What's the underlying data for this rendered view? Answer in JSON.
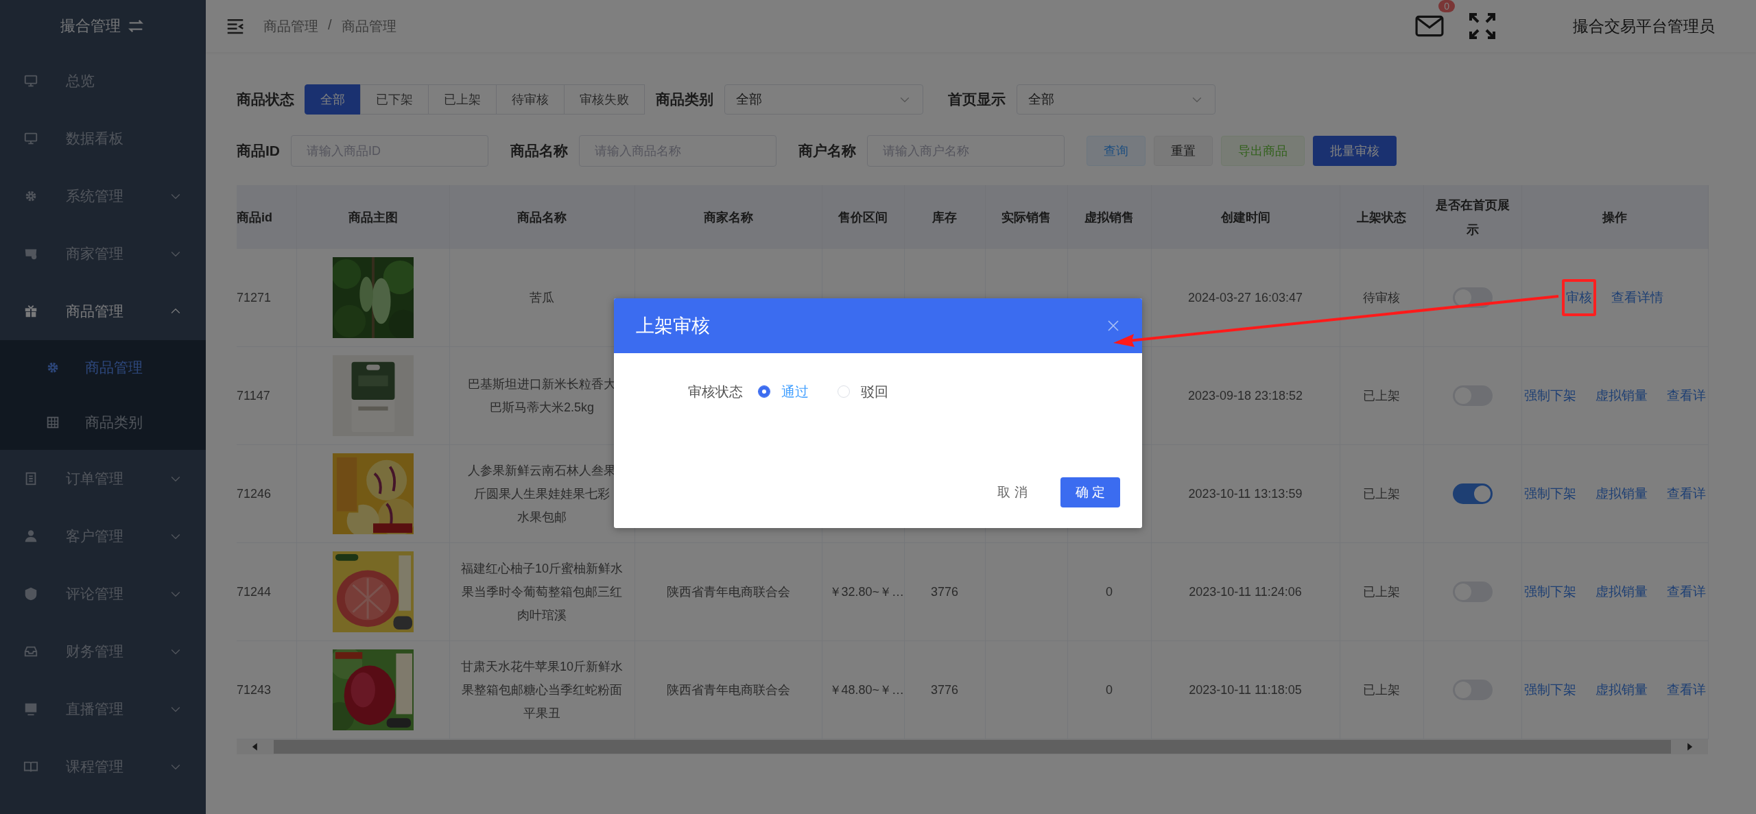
{
  "sidebar": {
    "title": "撮合管理",
    "items": [
      {
        "label": "总览"
      },
      {
        "label": "数据看板"
      },
      {
        "label": "系统管理",
        "expanded": false
      },
      {
        "label": "商家管理",
        "expanded": false
      },
      {
        "label": "商品管理",
        "expanded": true,
        "children": [
          {
            "label": "商品管理",
            "selected": true
          },
          {
            "label": "商品类别",
            "selected": false
          }
        ]
      },
      {
        "label": "订单管理",
        "expanded": false
      },
      {
        "label": "客户管理",
        "expanded": false
      },
      {
        "label": "评论管理",
        "expanded": false
      },
      {
        "label": "财务管理",
        "expanded": false
      },
      {
        "label": "直播管理",
        "expanded": false
      },
      {
        "label": "课程管理",
        "expanded": false
      }
    ]
  },
  "header": {
    "breadcrumb": [
      "商品管理",
      "商品管理"
    ],
    "breadcrumb_separator": "/",
    "notification_count": "0",
    "user_name": "撮合交易平台管理员"
  },
  "filters": {
    "status": {
      "label": "商品状态",
      "options": [
        {
          "label": "全部",
          "selected": true
        },
        {
          "label": "已下架",
          "selected": false
        },
        {
          "label": "已上架",
          "selected": false
        },
        {
          "label": "待审核",
          "selected": false
        },
        {
          "label": "审核失败",
          "selected": false
        }
      ]
    },
    "selects": [
      {
        "label": "商品类别",
        "value": "全部"
      },
      {
        "label": "首页显示",
        "value": "全部"
      }
    ],
    "inputs": [
      {
        "label": "商品ID",
        "placeholder": "请输入商品ID"
      },
      {
        "label": "商品名称",
        "placeholder": "请输入商品名称"
      },
      {
        "label": "商户名称",
        "placeholder": "请输入商户名称"
      }
    ],
    "buttons": [
      {
        "label": "查询",
        "kind": "info"
      },
      {
        "label": "重置",
        "kind": "plain"
      },
      {
        "label": "导出商品",
        "kind": "success"
      },
      {
        "label": "批量审核",
        "kind": "primary"
      }
    ]
  },
  "table": {
    "columns": [
      "商品id",
      "商品主图",
      "商品名称",
      "商家名称",
      "售价区间",
      "库存",
      "实际销售",
      "虚拟销售",
      "创建时间",
      "上架状态",
      "是否在首页展示",
      "操作"
    ],
    "rows": [
      {
        "id": "71271",
        "image": {
          "kind": "picture"
        },
        "name": [
          "苦瓜"
        ],
        "created": "2024-03-27 16:03:47",
        "status": "待审核",
        "home_display": false,
        "actions": [
          {
            "label": "审核",
            "highlighted": true
          },
          {
            "label": "查看详情"
          }
        ]
      },
      {
        "id": "71147",
        "image": {
          "kind": "picture"
        },
        "name": [
          "巴基斯坦进口新米长粒香大",
          "巴斯马蒂大米2.5kg"
        ],
        "created": "2023-09-18 23:18:52",
        "status": "已上架",
        "home_display": false,
        "actions": [
          {
            "label": "强制下架"
          },
          {
            "label": "虚拟销量"
          },
          {
            "label": "查看详"
          }
        ]
      },
      {
        "id": "71246",
        "image": {
          "kind": "picture"
        },
        "name": [
          "人参果新鲜云南石林人叁果",
          "斤圆果人生果娃娃果七彩",
          "水果包邮"
        ],
        "created": "2023-10-11 13:13:59",
        "status": "已上架",
        "home_display": true,
        "actions": [
          {
            "label": "强制下架"
          },
          {
            "label": "虚拟销量"
          },
          {
            "label": "查看详"
          }
        ]
      },
      {
        "id": "71244",
        "image": {
          "kind": "picture"
        },
        "name": [
          "福建红心柚子10斤蜜柚新鲜水",
          "果当季时令葡萄整箱包邮三红",
          "肉叶琯溪"
        ],
        "merchant": "陕西省青年电商联合会",
        "price": "￥32.80~￥…",
        "stock": "3776",
        "virtual_sales": "0",
        "created": "2023-10-11 11:24:06",
        "status": "已上架",
        "home_display": false,
        "actions": [
          {
            "label": "强制下架"
          },
          {
            "label": "虚拟销量"
          },
          {
            "label": "查看详"
          }
        ]
      },
      {
        "id": "71243",
        "image": {
          "kind": "picture"
        },
        "name": [
          "甘肃天水花牛苹果10斤新鲜水",
          "果整箱包邮糖心当季红蛇粉面",
          "平果丑"
        ],
        "merchant": "陕西省青年电商联合会",
        "price": "￥48.80~￥…",
        "stock": "3776",
        "virtual_sales": "0",
        "created": "2023-10-11 11:18:05",
        "status": "已上架",
        "home_display": false,
        "actions": [
          {
            "label": "强制下架"
          },
          {
            "label": "虚拟销量"
          },
          {
            "label": "查看详"
          }
        ]
      }
    ]
  },
  "dialog": {
    "title": "上架审核",
    "field_label": "审核状态",
    "options": [
      {
        "label": "通过",
        "selected": true
      },
      {
        "label": "驳回",
        "selected": false
      }
    ],
    "buttons": [
      {
        "label": "取 消",
        "kind": "text"
      },
      {
        "label": "确 定",
        "kind": "primary"
      }
    ]
  }
}
